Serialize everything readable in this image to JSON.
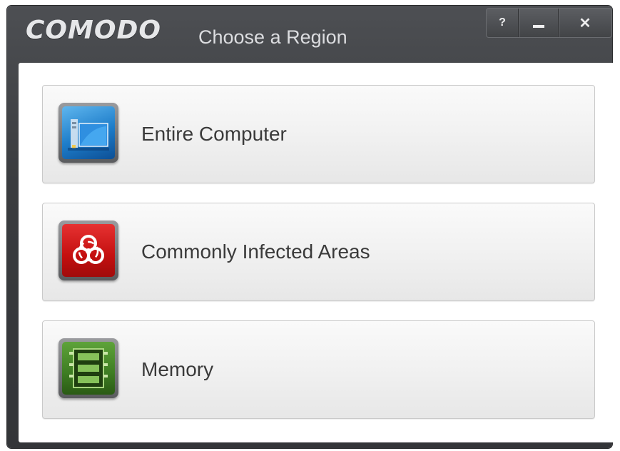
{
  "window": {
    "brand": "COMODO",
    "title": "Choose a Region",
    "controls": {
      "help": "?",
      "close": "✕"
    }
  },
  "options": [
    {
      "label": "Entire Computer",
      "icon": "computer-icon"
    },
    {
      "label": "Commonly Infected Areas",
      "icon": "biohazard-icon"
    },
    {
      "label": "Memory",
      "icon": "memory-chip-icon"
    }
  ],
  "colors": {
    "titlebar": "#3a3c3f",
    "computer_icon": "#1d7cc9",
    "biohazard_icon": "#c40f0f",
    "memory_icon": "#3d7c22"
  }
}
